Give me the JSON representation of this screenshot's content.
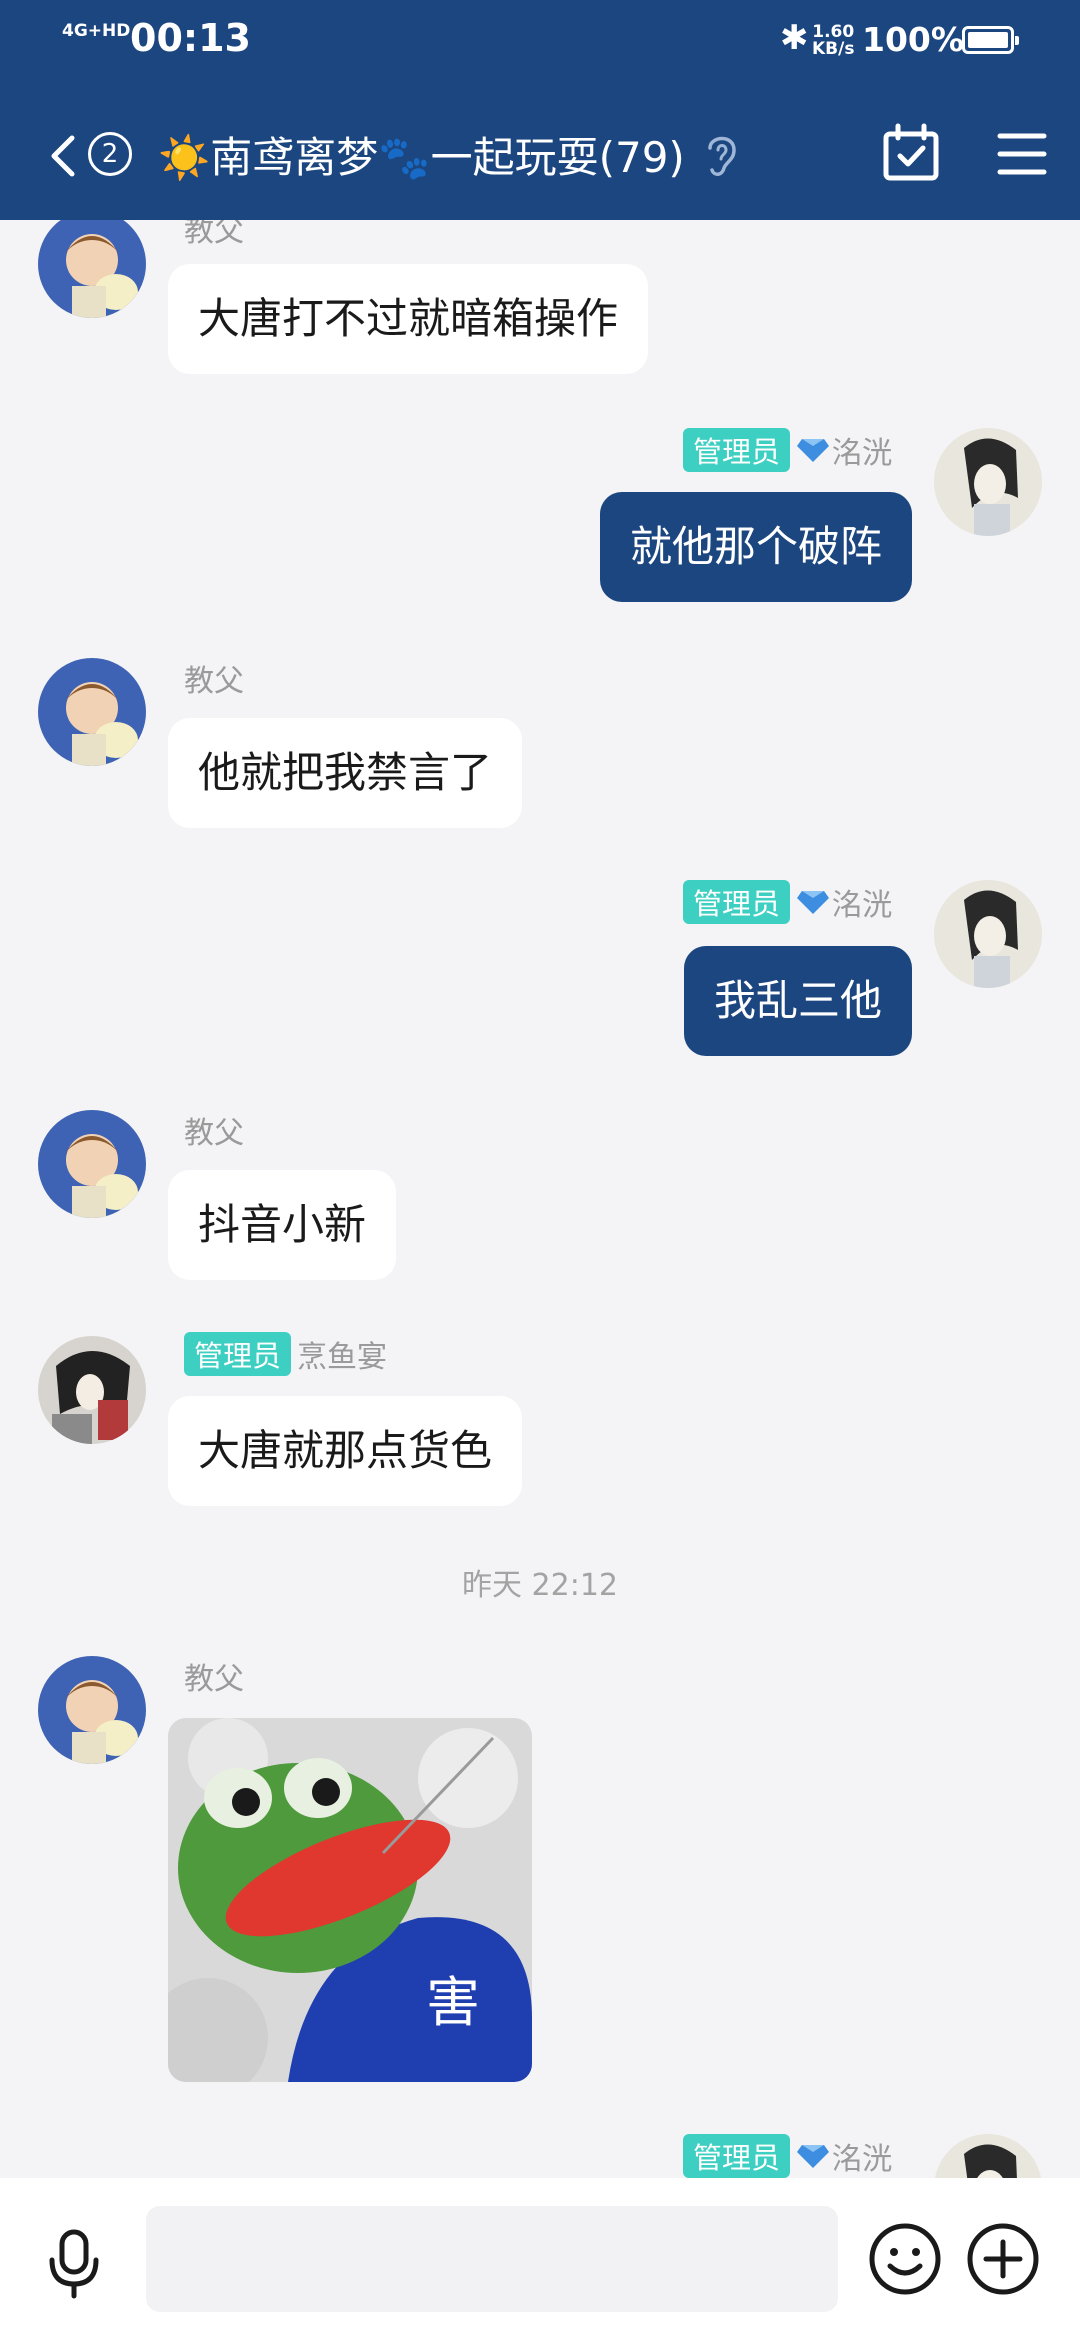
{
  "status": {
    "network": "4G+HD",
    "time": "00:13",
    "speed": "1.60",
    "speed_unit": "KB/s",
    "battery": "100%"
  },
  "header": {
    "back_icon": "chevron-left-icon",
    "unread_count": "2",
    "title": "☀️南鸢离梦🐾一起玩耍(79)",
    "ear_icon": "ear-icon",
    "calendar_icon": "calendar-check-icon",
    "menu_icon": "hamburger-menu-icon",
    "color": "#1c4680"
  },
  "messages": [
    {
      "side": "left",
      "sender": "教父",
      "text": "大唐打不过就暗箱操作"
    },
    {
      "side": "right",
      "role": "管理员",
      "sender": "洺洸",
      "text": "就他那个破阵"
    },
    {
      "side": "left",
      "sender": "教父",
      "text": "他就把我禁言了"
    },
    {
      "side": "right",
      "role": "管理员",
      "sender": "洺洸",
      "text": "我乱三他"
    },
    {
      "side": "left",
      "sender": "教父",
      "text": "抖音小新"
    },
    {
      "side": "left",
      "role": "管理员",
      "sender": "烹鱼宴",
      "text": "大唐就那点货色"
    },
    {
      "timestamp": "昨天 22:12"
    },
    {
      "side": "left",
      "sender": "教父",
      "sticker_text": "害"
    },
    {
      "side": "right",
      "role": "管理员",
      "sender": "洺洸"
    }
  ],
  "colors": {
    "outgoing_bubble": "#1c4680",
    "admin_tag": "#3ccfc2",
    "background": "#f4f4f6"
  },
  "input": {
    "mic_icon": "microphone-icon",
    "emoji_icon": "smiley-icon",
    "plus_icon": "plus-circle-icon"
  }
}
